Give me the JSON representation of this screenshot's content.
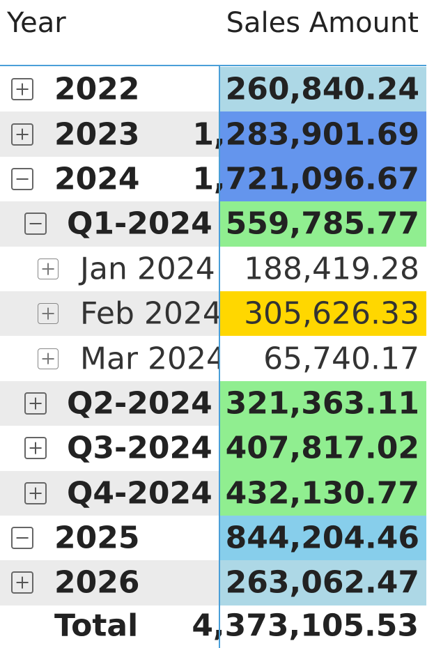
{
  "header": {
    "year_label": "Year",
    "sales_label": "Sales Amount"
  },
  "rows": [
    {
      "label": "2022",
      "value": "260,840.24",
      "level": 1,
      "toggle": "plus",
      "bg": "#add8e6",
      "shade": false
    },
    {
      "label": "2023",
      "value": "1,283,901.69",
      "level": 1,
      "toggle": "plus",
      "bg": "#6495ed",
      "shade": true
    },
    {
      "label": "2024",
      "value": "1,721,096.67",
      "level": 1,
      "toggle": "minus",
      "bg": "#6495ed",
      "shade": false
    },
    {
      "label": "Q1-2024",
      "value": "559,785.77",
      "level": 2,
      "toggle": "minus",
      "bg": "#90ee90",
      "shade": true
    },
    {
      "label": "Jan 2024",
      "value": "188,419.28",
      "level": 3,
      "toggle": "plus",
      "bg": "#ffffff",
      "shade": false
    },
    {
      "label": "Feb 2024",
      "value": "305,626.33",
      "level": 3,
      "toggle": "plus",
      "bg": "#ffd700",
      "shade": true
    },
    {
      "label": "Mar 2024",
      "value": "65,740.17",
      "level": 3,
      "toggle": "plus",
      "bg": "#ffffff",
      "shade": false
    },
    {
      "label": "Q2-2024",
      "value": "321,363.11",
      "level": 2,
      "toggle": "plus",
      "bg": "#90ee90",
      "shade": true
    },
    {
      "label": "Q3-2024",
      "value": "407,817.02",
      "level": 2,
      "toggle": "plus",
      "bg": "#90ee90",
      "shade": false
    },
    {
      "label": "Q4-2024",
      "value": "432,130.77",
      "level": 2,
      "toggle": "plus",
      "bg": "#90ee90",
      "shade": true
    },
    {
      "label": "2025",
      "value": "844,204.46",
      "level": 1,
      "toggle": "minus",
      "bg": "#87ceeb",
      "shade": false
    },
    {
      "label": "2026",
      "value": "263,062.47",
      "level": 1,
      "toggle": "plus",
      "bg": "#add8e6",
      "shade": true
    }
  ],
  "total": {
    "label": "Total",
    "value": "4,373,105.53"
  },
  "colors": {
    "divider": "#4a9fd8",
    "row_shade": "#ebebeb"
  }
}
